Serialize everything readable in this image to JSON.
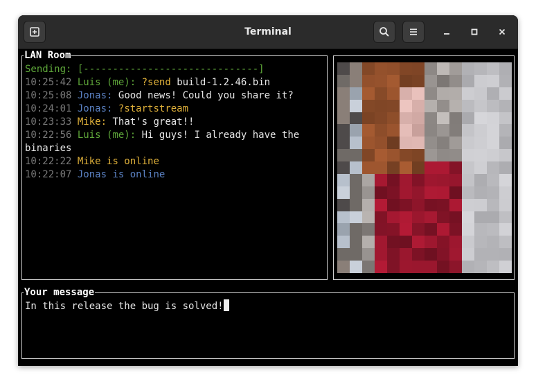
{
  "window": {
    "title": "Terminal",
    "new_tab_icon": "new-tab-icon",
    "search_icon": "search-icon",
    "menu_icon": "hamburger-menu-icon",
    "minimize_glyph": "–",
    "maximize_glyph": "□",
    "close_glyph": "×"
  },
  "chat": {
    "title": "LAN Room",
    "sending_label": "Sending:",
    "sending_bar": "[------------------------------]",
    "messages": [
      {
        "time": "10:25:42",
        "sender": "Luis (me):",
        "command": "?send",
        "text": " build-1.2.46.bin"
      },
      {
        "time": "10:25:08",
        "sender": "Jonas:",
        "text": "Good news! Could you share it?"
      },
      {
        "time": "10:24:01",
        "sender": "Jonas:",
        "command": "?startstream"
      },
      {
        "time": "10:23:33",
        "sender": "Mike:",
        "text": "That's great!!"
      },
      {
        "time": "10:22:56",
        "sender": "Luis (me):",
        "text": "Hi guys! I already have the",
        "text_wrap": "binaries"
      },
      {
        "time": "10:22:22",
        "status": "Mike is online"
      },
      {
        "time": "10:22:07",
        "status": "Jonas is online"
      }
    ]
  },
  "video": {
    "description": "video-stream"
  },
  "input": {
    "title": "Your message",
    "value": "In this release the bug is solved!"
  },
  "colors": {
    "green": "#5fa83a",
    "blue": "#5b82c4",
    "yellow": "#e0b13a",
    "timestamp": "#7a7a7a",
    "border": "#d0d0d0"
  }
}
